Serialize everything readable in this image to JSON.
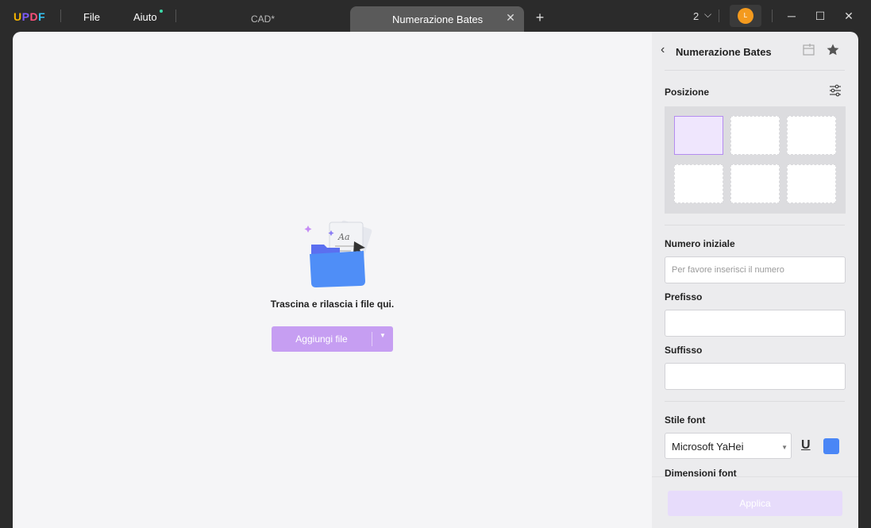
{
  "titlebar": {
    "logo_letters": [
      "U",
      "P",
      "D",
      "F"
    ],
    "logo_colors": [
      "#f5b400",
      "#7c5cff",
      "#ff4f7b",
      "#35c3f3"
    ],
    "menu_file": "File",
    "menu_help": "Aiuto",
    "tab_inactive": "CAD*",
    "tab_active": "Numerazione Bates",
    "tab_close_icon": "close-icon",
    "tab_add_icon": "plus-icon",
    "page_count": "2",
    "avatar_initial": "L",
    "avatar_color": "#f49a1e"
  },
  "main": {
    "drop_text": "Trascina e rilascia i file qui.",
    "add_button": "Aggiungi file",
    "button_color": "#c69ef2"
  },
  "panel": {
    "title": "Numerazione Bates",
    "position_label": "Posizione",
    "selected_position": "top-left",
    "start_number_label": "Numero iniziale",
    "start_number_placeholder": "Per favore inserisci il numero",
    "prefix_label": "Prefisso",
    "suffix_label": "Suffisso",
    "font_style_label": "Stile font",
    "font_value": "Microsoft YaHei",
    "underline_label": "U",
    "font_color": "#4a86f6",
    "font_size_label": "Dimensioni font",
    "apply_button": "Applica"
  }
}
